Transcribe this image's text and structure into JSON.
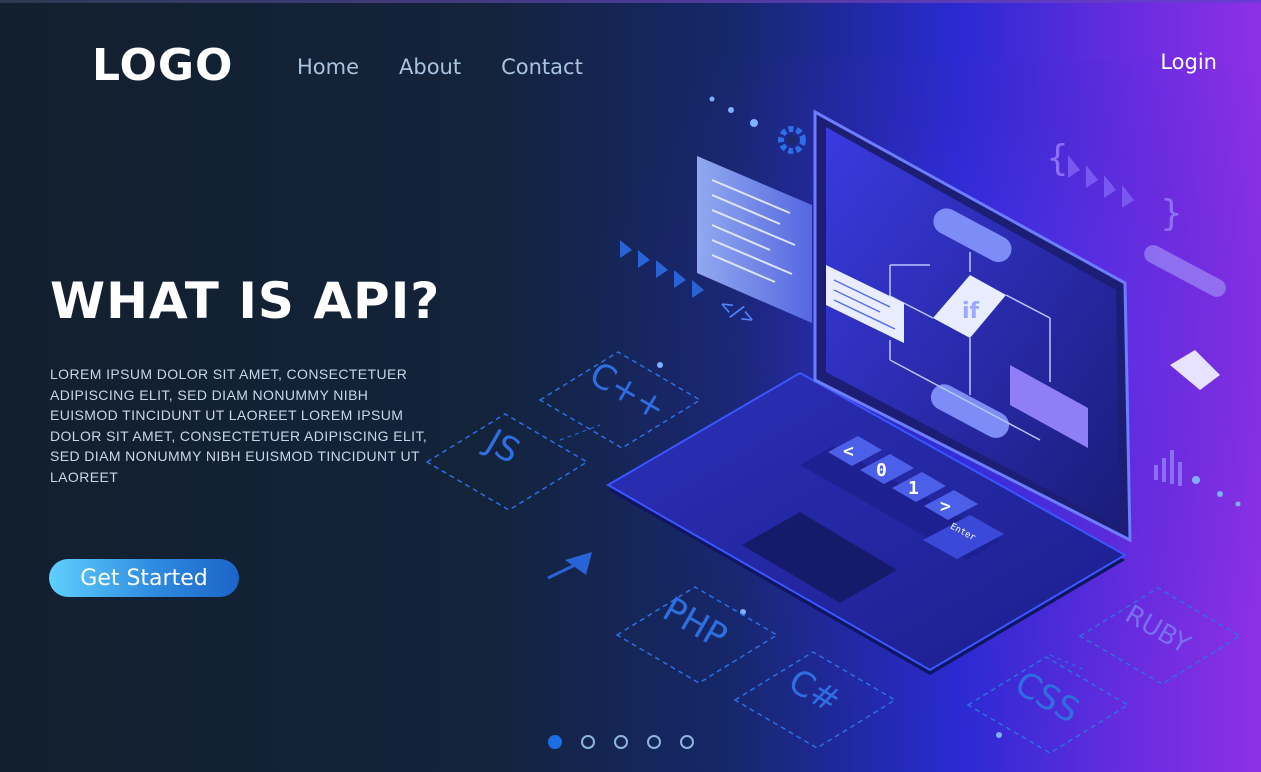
{
  "brand": {
    "logo_text": "LOGO"
  },
  "nav": {
    "items": [
      "Home",
      "About",
      "Contact"
    ],
    "login_label": "Login"
  },
  "hero": {
    "title": "WHAT IS API?",
    "body": "LOREM IPSUM DOLOR SIT AMET, CONSECTETUER ADIPISCING ELIT, SED DIAM NONUMMY NIBH EUISMOD TINCIDUNT UT LAOREET LOREM IPSUM DOLOR SIT AMET, CONSECTETUER ADIPISCING ELIT, SED DIAM NONUMMY NIBH EUISMOD TINCIDUNT UT LAOREET",
    "cta_label": "Get Started"
  },
  "illustration": {
    "language_tags": [
      "C++",
      "JS",
      "PHP",
      "C#",
      "CSS",
      "RUBY"
    ],
    "keyboard_keys": [
      "<",
      "0",
      "1",
      ">"
    ],
    "enter_key": "Enter",
    "flowchart_label": "if",
    "code_symbol": "</>",
    "brace_open": "{",
    "brace_close": "}"
  },
  "carousel": {
    "total": 5,
    "active_index": 0
  },
  "colors": {
    "accent": "#1b6fe0",
    "cta_start": "#5fd0ff",
    "cta_end": "#1c64c8",
    "background_dark": "#121f2e",
    "background_purple": "#8e30e6"
  }
}
